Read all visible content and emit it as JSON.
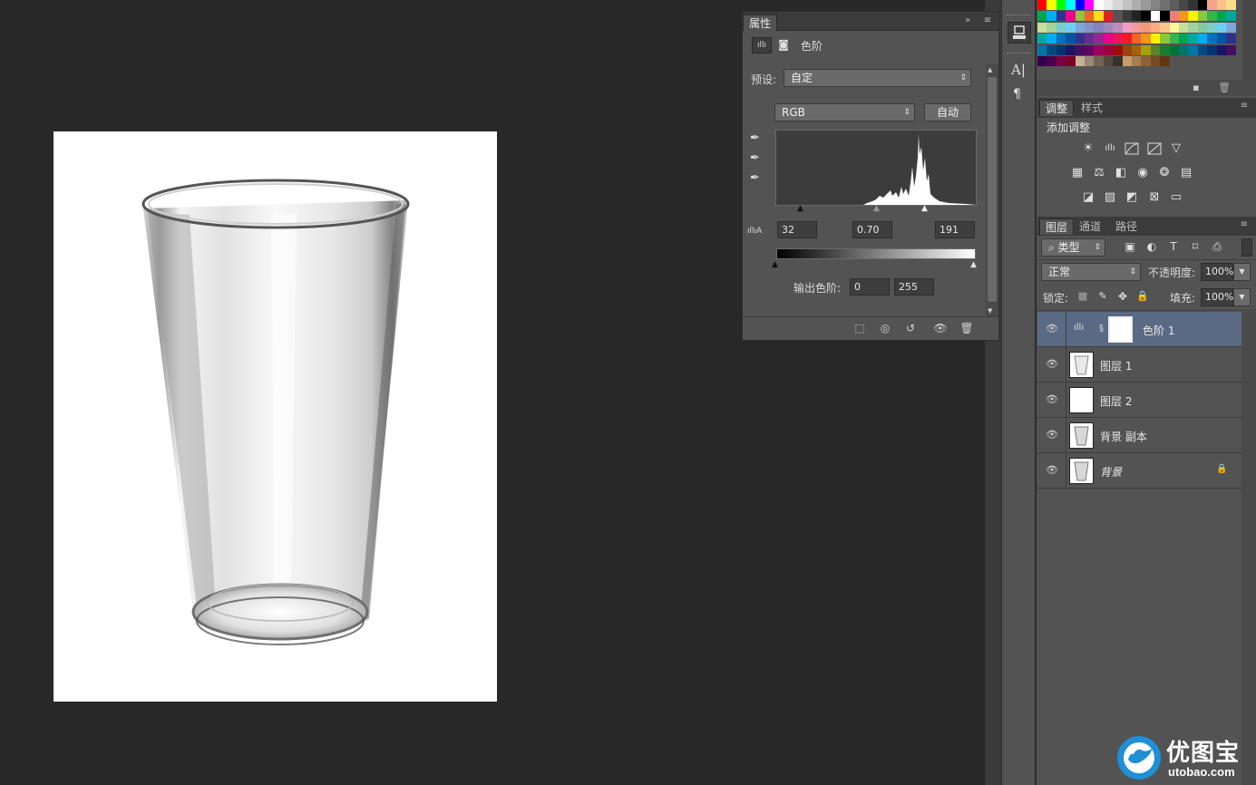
{
  "properties_panel": {
    "tab_label": "属性",
    "section_title": "色阶",
    "preset_label": "预设:",
    "preset_value": "自定",
    "channel_value": "RGB",
    "auto_button": "自动",
    "input_levels": {
      "black": "32",
      "gamma": "0.70",
      "white": "191"
    },
    "output_label": "输出色阶:",
    "output_levels": {
      "black": "0",
      "white": "255"
    }
  },
  "adjustments_panel": {
    "tabs": [
      "调整",
      "样式"
    ],
    "title": "添加调整"
  },
  "layers_panel": {
    "tabs": [
      "图层",
      "通道",
      "路径"
    ],
    "filter_kind": "类型",
    "blend_mode": "正常",
    "opacity_label": "不透明度:",
    "opacity_value": "100%",
    "lock_label": "锁定:",
    "fill_label": "填充:",
    "fill_value": "100%",
    "layers": [
      {
        "name": "色阶 1",
        "selected": true
      },
      {
        "name": "图层 1",
        "selected": false
      },
      {
        "name": "图层 2",
        "selected": false
      },
      {
        "name": "背景 副本",
        "selected": false
      },
      {
        "name": "背景",
        "selected": false,
        "locked": true
      }
    ]
  },
  "watermark": {
    "brand": "优图宝",
    "url": "utobao.com"
  },
  "colors": {
    "app_bg": "#282828",
    "panel_bg": "#535353",
    "selected_layer": "#5a6a84",
    "watermark_blue": "#1f8fd6"
  },
  "icons": [
    "levels-icon",
    "mask-icon",
    "eyedropper-black-icon",
    "eyedropper-gray-icon",
    "eyedropper-white-icon",
    "eye-icon",
    "lock-icon",
    "trash-icon",
    "chain-link-icon",
    "brightness-icon",
    "curves-icon",
    "exposure-icon",
    "vibrance-icon",
    "hue-saturation-icon",
    "color-balance-icon",
    "black-white-icon",
    "photo-filter-icon",
    "channel-mixer-icon",
    "color-lookup-icon",
    "invert-icon",
    "posterize-icon",
    "threshold-icon",
    "selective-color-icon",
    "gradient-map-icon"
  ]
}
